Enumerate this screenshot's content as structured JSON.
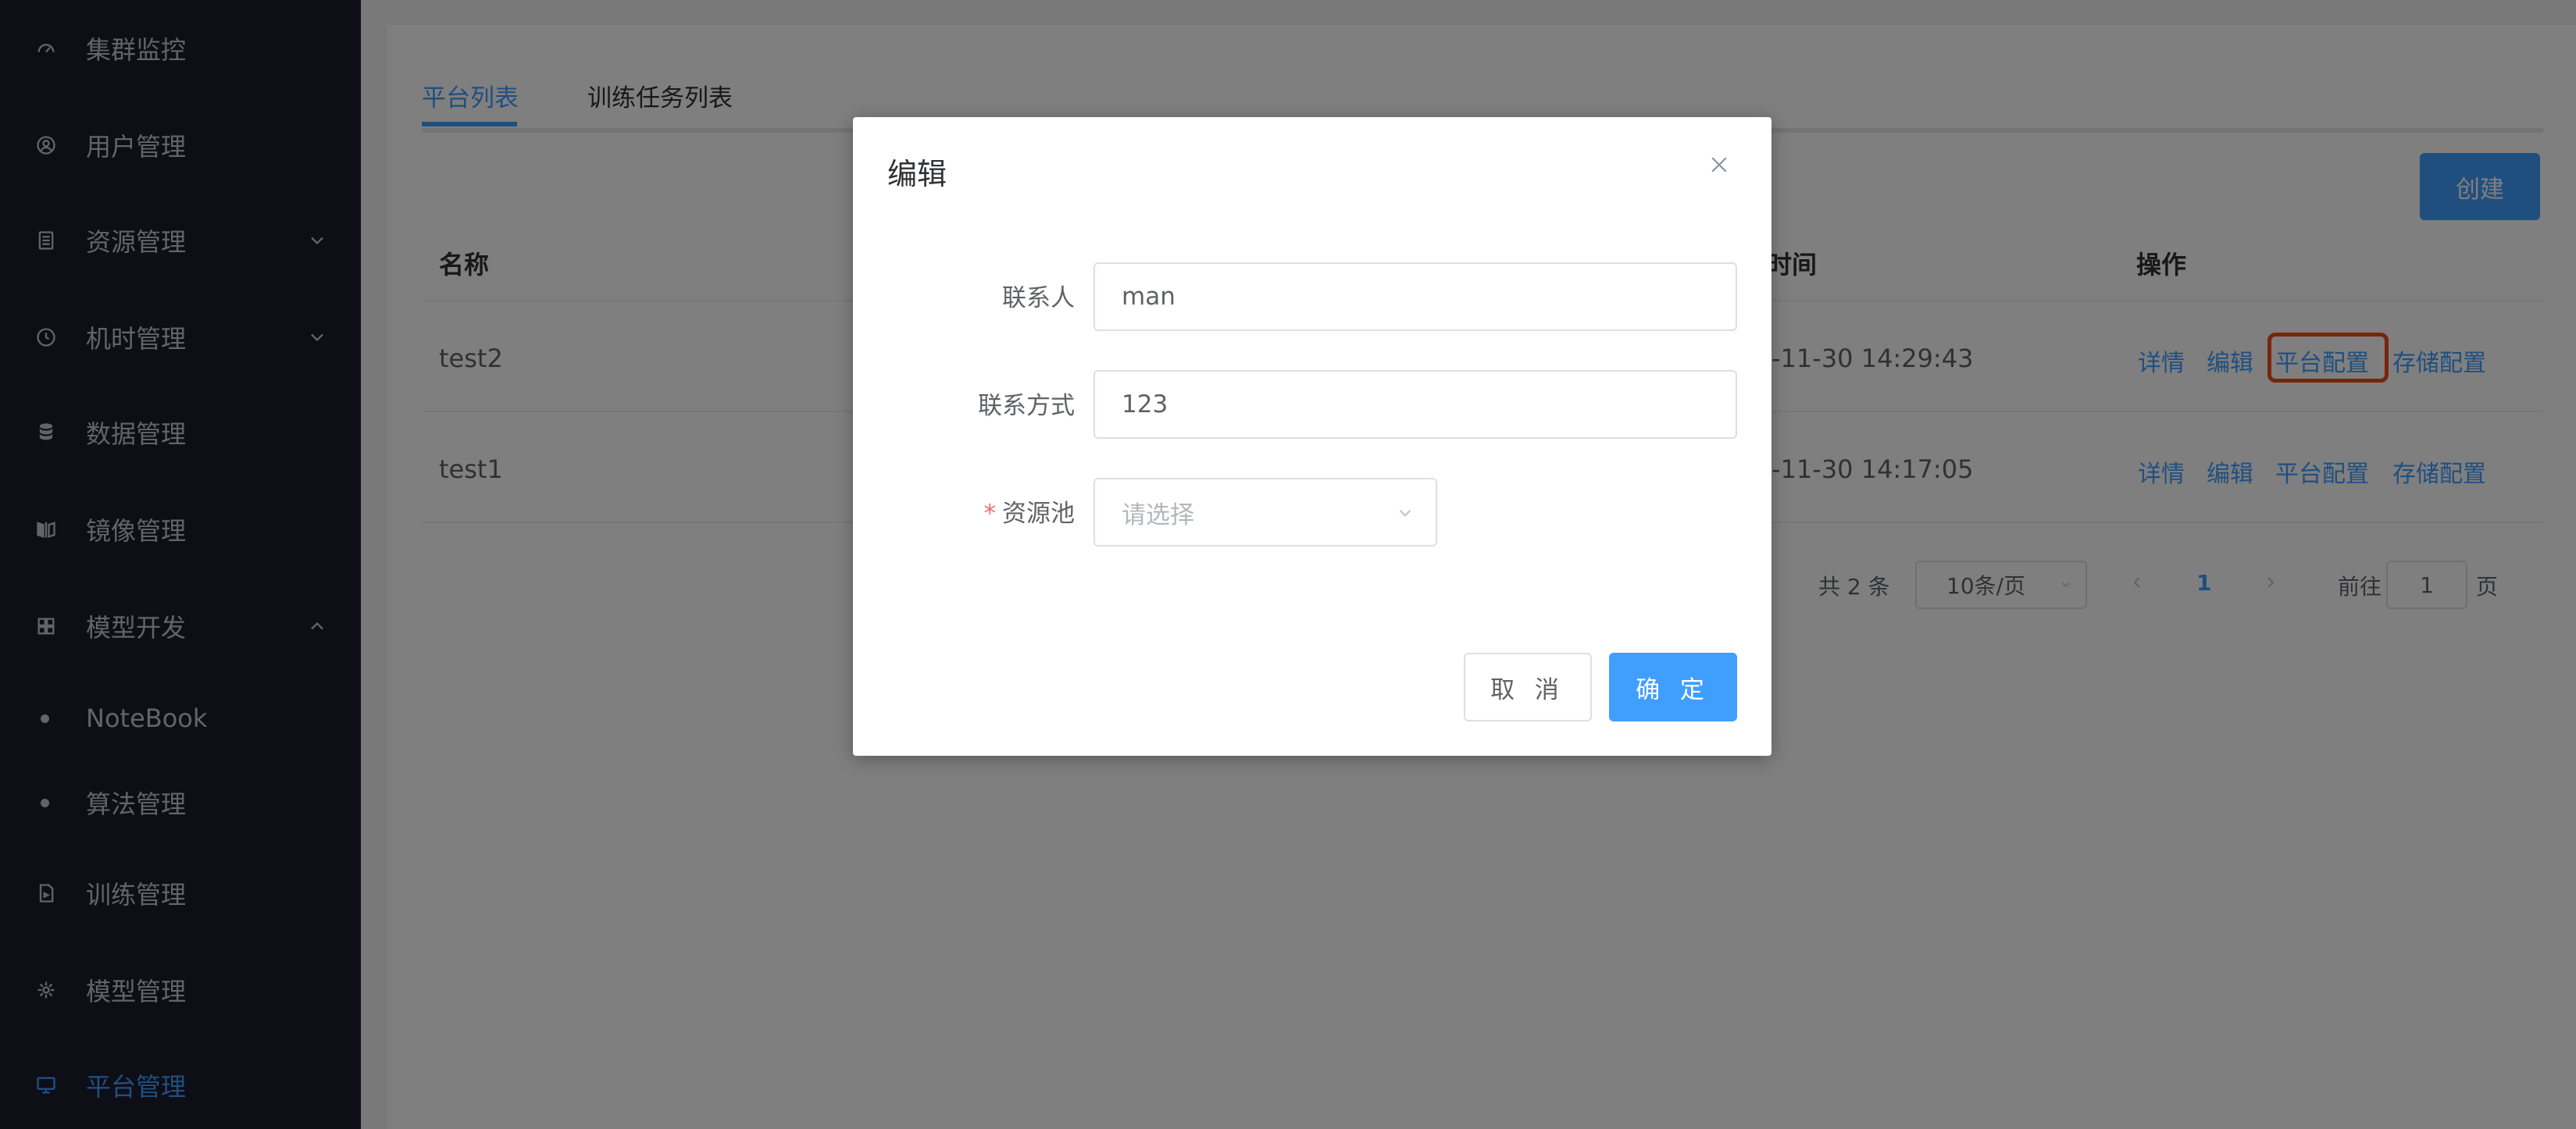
{
  "sidebar": {
    "items": [
      {
        "label": "集群监控",
        "icon": "dashboard-icon"
      },
      {
        "label": "用户管理",
        "icon": "user-icon"
      },
      {
        "label": "资源管理",
        "icon": "document-icon",
        "expandable": true
      },
      {
        "label": "机时管理",
        "icon": "clock-icon",
        "expandable": true
      },
      {
        "label": "数据管理",
        "icon": "database-icon"
      },
      {
        "label": "镜像管理",
        "icon": "mirror-icon"
      },
      {
        "label": "模型开发",
        "icon": "grid-icon",
        "expanded": true
      },
      {
        "label": "NoteBook",
        "sub": true
      },
      {
        "label": "算法管理",
        "sub": true
      },
      {
        "label": "训练管理",
        "icon": "file-icon"
      },
      {
        "label": "模型管理",
        "icon": "model-icon"
      },
      {
        "label": "平台管理",
        "icon": "monitor-icon",
        "active": true
      }
    ]
  },
  "main": {
    "tabs": [
      {
        "label": "平台列表",
        "active": true
      },
      {
        "label": "训练任务列表"
      }
    ],
    "create_label": "创建",
    "table": {
      "headers": {
        "name": "名称",
        "time": "时间",
        "actions": "操作"
      },
      "rows": [
        {
          "name": "test2",
          "time": "-11-30 14:29:43"
        },
        {
          "name": "test1",
          "time": "-11-30 14:17:05"
        }
      ],
      "actions": [
        "详情",
        "编辑",
        "平台配置",
        "存储配置"
      ]
    },
    "pagination": {
      "total": "共 2 条",
      "page_size": "10条/页",
      "current": "1",
      "goto_label": "前往",
      "goto_value": "1",
      "page_label": "页"
    }
  },
  "dialog": {
    "title": "编辑",
    "fields": [
      {
        "label": "联系人",
        "value": "man"
      },
      {
        "label": "联系方式",
        "value": "123"
      },
      {
        "label": "资源池",
        "placeholder": "请选择",
        "required": "*"
      }
    ],
    "cancel_label": "取 消",
    "ok_label": "确 定"
  },
  "colors": {
    "primary": "#409eff",
    "sidebar_bg": "#1c1d2e",
    "highlight": "#f04a1a",
    "required": "#f56c6c"
  }
}
